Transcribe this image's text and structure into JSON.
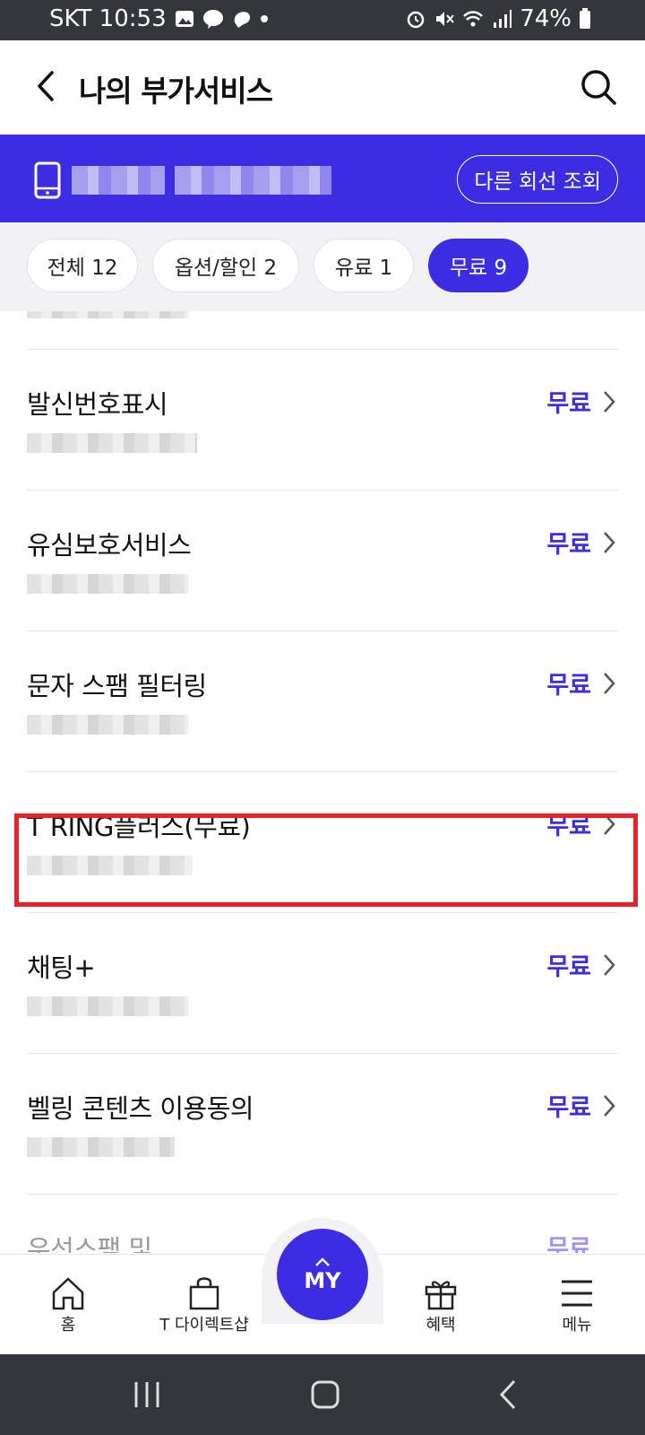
{
  "status_bar": {
    "carrier_time": "SKT 10:53",
    "battery": "74%"
  },
  "header": {
    "title": "나의 부가서비스"
  },
  "line_bar": {
    "other_line_button": "다른 회선 조회"
  },
  "tabs": [
    {
      "label": "전체 12",
      "active": false
    },
    {
      "label": "옵션/할인 2",
      "active": false
    },
    {
      "label": "유료 1",
      "active": false
    },
    {
      "label": "무료 9",
      "active": true
    }
  ],
  "services": [
    {
      "name": "발신번호표시",
      "price": "무료"
    },
    {
      "name": "유심보호서비스",
      "price": "무료",
      "highlighted": true
    },
    {
      "name": "문자 스팸 필터링",
      "price": "무료"
    },
    {
      "name": "T RING플러스(무료)",
      "price": "무료"
    },
    {
      "name": "채팅+",
      "price": "무료"
    },
    {
      "name": "벨링 콘텐츠 이용동의",
      "price": "무료"
    },
    {
      "name": "우선스팸 및",
      "price": "무료"
    }
  ],
  "bottom_nav": {
    "home": "홈",
    "shop": "T 다이렉트샵",
    "my": "MY",
    "benefits": "혜택",
    "menu": "메뉴"
  },
  "colors": {
    "accent": "#3d2de2",
    "highlight": "#e8212d",
    "system_bar": "#34363b"
  }
}
